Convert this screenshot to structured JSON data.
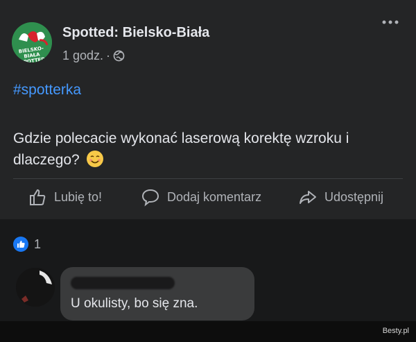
{
  "post": {
    "author": "Spotted: Bielsko-Biała",
    "time": "1 godz.",
    "separator": "·",
    "privacy_icon": "globe-icon",
    "menu_icon": "more-icon",
    "hashtag": "#spotterka",
    "text": "Gdzie polecacie wykonać laserową korektę wzroku i dlaczego?",
    "emoji": "smiling-face-icon",
    "avatar_text": "BIELSKO-BIAŁA SPOTTED"
  },
  "actions": [
    {
      "label": "Lubię to!",
      "icon": "thumbs-up-icon"
    },
    {
      "label": "Dodaj komentarz",
      "icon": "comment-icon"
    },
    {
      "label": "Udostępnij",
      "icon": "share-icon"
    }
  ],
  "reactions": {
    "count": "1",
    "icon": "like-reaction-icon"
  },
  "comment": {
    "text": "U okulisty, bo się zna."
  },
  "watermark": "Besty.pl",
  "colors": {
    "background": "#18191a",
    "card": "#242526",
    "link": "#4599ff",
    "like": "#1877f2",
    "bubble": "#3a3b3c"
  }
}
